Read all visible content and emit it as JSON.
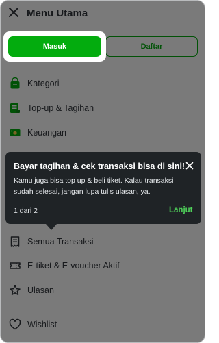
{
  "header": {
    "title": "Menu Utama",
    "close_icon": "close-icon"
  },
  "auth": {
    "login_label": "Masuk",
    "register_label": "Daftar"
  },
  "menu": {
    "items": [
      {
        "label": "Kategori",
        "icon": "category-bag-icon"
      },
      {
        "label": "Top-up & Tagihan",
        "icon": "bill-icon"
      },
      {
        "label": "Keuangan",
        "icon": "money-icon"
      },
      {
        "label": "Semua Transaksi",
        "icon": "receipt-icon"
      },
      {
        "label": "E-tiket & E-voucher Aktif",
        "icon": "ticket-icon"
      },
      {
        "label": "Ulasan",
        "icon": "star-icon"
      },
      {
        "label": "Wishlist",
        "icon": "heart-icon"
      }
    ]
  },
  "tooltip": {
    "title": "Bayar tagihan & cek transaksi bisa di sini!",
    "body": "Kamu juga bisa top up & beli tiket. Kalau transaksi sudah selesai, jangan lupa tulis ulasan, ya.",
    "step": "1 dari 2",
    "next_label": "Lanjut"
  },
  "colors": {
    "primary_green": "#03ac0e",
    "tooltip_bg": "#1f2326",
    "tooltip_accent": "#4fd15a"
  }
}
